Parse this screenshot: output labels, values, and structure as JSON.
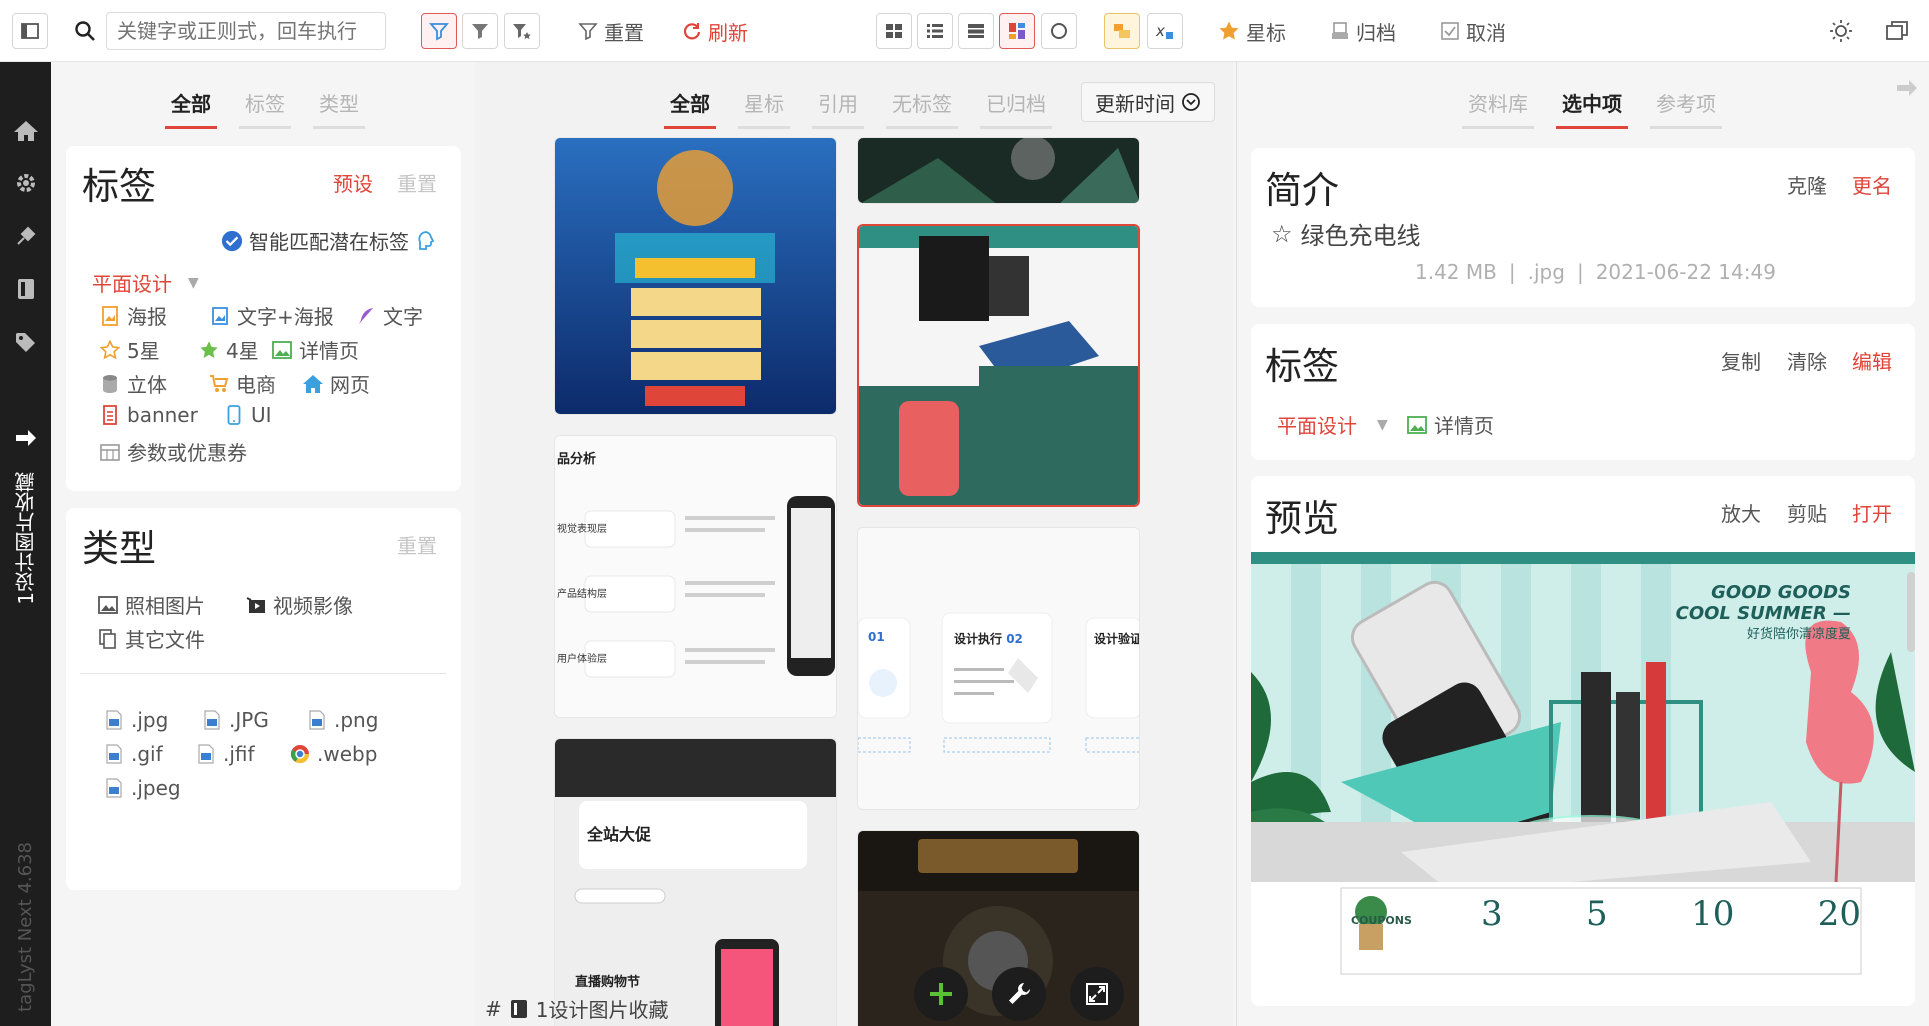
{
  "toolbar": {
    "search_placeholder": "关键字或正则式，回车执行",
    "reset": "重置",
    "refresh": "刷新",
    "star": "星标",
    "archive": "归档",
    "cancel": "取消"
  },
  "sidebar": {
    "collection_name": "1设计图片收藏",
    "version": "tagLyst Next 4.638"
  },
  "left": {
    "tabs": [
      "全部",
      "标签",
      "类型"
    ],
    "tags_card": {
      "title": "标签",
      "preset": "预设",
      "reset": "重置",
      "smart_match": "智能匹配潜在标签",
      "group": "平面设计",
      "items": [
        {
          "label": "海报",
          "icon": "poster-icon"
        },
        {
          "label": "文字+海报",
          "icon": "image-text-icon"
        },
        {
          "label": "文字",
          "icon": "feather-icon"
        },
        {
          "label": "5星",
          "icon": "star-outline-icon"
        },
        {
          "label": "4星",
          "icon": "star-filled-icon"
        },
        {
          "label": "详情页",
          "icon": "picture-icon"
        },
        {
          "label": "立体",
          "icon": "database-icon"
        },
        {
          "label": "电商",
          "icon": "cart-icon"
        },
        {
          "label": "网页",
          "icon": "home-icon"
        },
        {
          "label": "banner",
          "icon": "banner-icon"
        },
        {
          "label": "UI",
          "icon": "mobile-icon"
        },
        {
          "label": "参数或优惠券",
          "icon": "calendar-icon"
        }
      ]
    },
    "types_card": {
      "title": "类型",
      "reset": "重置",
      "kinds": [
        "照相图片",
        "视频影像",
        "其它文件"
      ],
      "extensions": [
        ".jpg",
        ".JPG",
        ".png",
        ".gif",
        ".jfif",
        ".webp",
        ".jpeg"
      ]
    }
  },
  "center": {
    "tabs": [
      "全部",
      "星标",
      "引用",
      "无标签",
      "已归档"
    ],
    "sort_label": "更新时间",
    "footer_prefix": "#",
    "footer_collection": "1设计图片收藏",
    "thumbs": {
      "t5_text1": "设计执行",
      "t5_num1": "02",
      "t5_text2": "设计验证",
      "t5_num0": "01",
      "t4_title": "品分析",
      "t6_title": "全站大促",
      "t6_sub": "直播购物节",
      "t4_r1": "视觉表现层",
      "t4_r2": "产品结构层",
      "t4_r3": "用户体验层"
    }
  },
  "right": {
    "tabs": [
      "资料库",
      "选中项",
      "参考项"
    ],
    "intro": {
      "title": "简介",
      "clone": "克隆",
      "rename": "更名",
      "filename": "绿色充电线",
      "size": "1.42 MB",
      "ext": ".jpg",
      "date": "2021-06-22 14:49"
    },
    "tags": {
      "title": "标签",
      "copy": "复制",
      "clear": "清除",
      "edit": "编辑",
      "group": "平面设计",
      "item": "详情页"
    },
    "preview": {
      "title": "预览",
      "zoom": "放大",
      "paste": "剪贴",
      "open": "打开",
      "headline1": "GOOD GOODS",
      "headline2": "COOL SUMMER —",
      "sub": "好货陪你清凉度夏",
      "coupons": "COUPONS",
      "prices": [
        "3",
        "5",
        "10",
        "20"
      ]
    }
  },
  "colors": {
    "accent": "#e0453a",
    "dark": "#1e1e1e",
    "teal": "#2f8f82"
  }
}
